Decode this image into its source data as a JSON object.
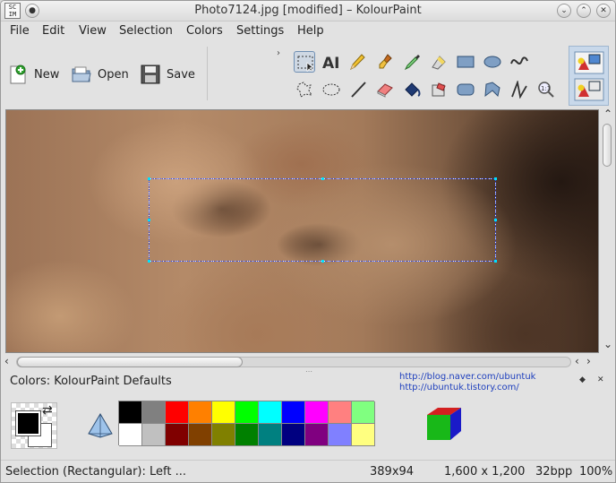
{
  "window": {
    "title": "Photo7124.jpg [modified] – KolourPaint",
    "app_icon_label": "SC IM"
  },
  "menu": {
    "items": [
      "File",
      "Edit",
      "View",
      "Selection",
      "Colors",
      "Settings",
      "Help"
    ],
    "mnemonic_index": [
      0,
      0,
      0,
      null,
      0,
      0,
      0
    ]
  },
  "toolbar": {
    "new_label": "New",
    "open_label": "Open",
    "save_label": "Save"
  },
  "tools": {
    "row1": [
      "rectangular-selection-icon",
      "text-tool-icon",
      "pencil-icon",
      "brush-icon",
      "color-picker-icon",
      "eraser-rainbow-icon",
      "rectangle-icon",
      "ellipse-icon",
      "curve-icon"
    ],
    "row2": [
      "free-form-selection-icon",
      "elliptical-selection-icon",
      "line-icon",
      "eraser-icon",
      "flood-fill-icon",
      "color-eraser-icon",
      "rounded-rectangle-icon",
      "polygon-icon",
      "polyline-icon",
      "zoom-icon"
    ],
    "active_tool": "rectangular-selection-icon"
  },
  "colors_panel": {
    "title": "Colors: KolourPaint Defaults",
    "links": [
      "http://blog.naver.com/ubuntuk",
      "http://ubuntuk.tistory.com/"
    ],
    "foreground": "#000000",
    "background": "#ffffff",
    "palette_row1": [
      "#000000",
      "#808080",
      "#ff0000",
      "#ff8000",
      "#ffff00",
      "#00ff00",
      "#00ffff",
      "#0000ff",
      "#ff00ff",
      "#ff8080",
      "#80ff80"
    ],
    "palette_row2": [
      "#ffffff",
      "#c0c0c0",
      "#800000",
      "#804000",
      "#808000",
      "#008000",
      "#008080",
      "#000080",
      "#800080",
      "#8080ff",
      "#ffff80"
    ]
  },
  "status": {
    "mode": "Selection (Rectangular): Left ...",
    "selection_size": "389x94",
    "image_size": "1,600 x 1,200",
    "depth": "32bpp",
    "zoom": "100%"
  }
}
